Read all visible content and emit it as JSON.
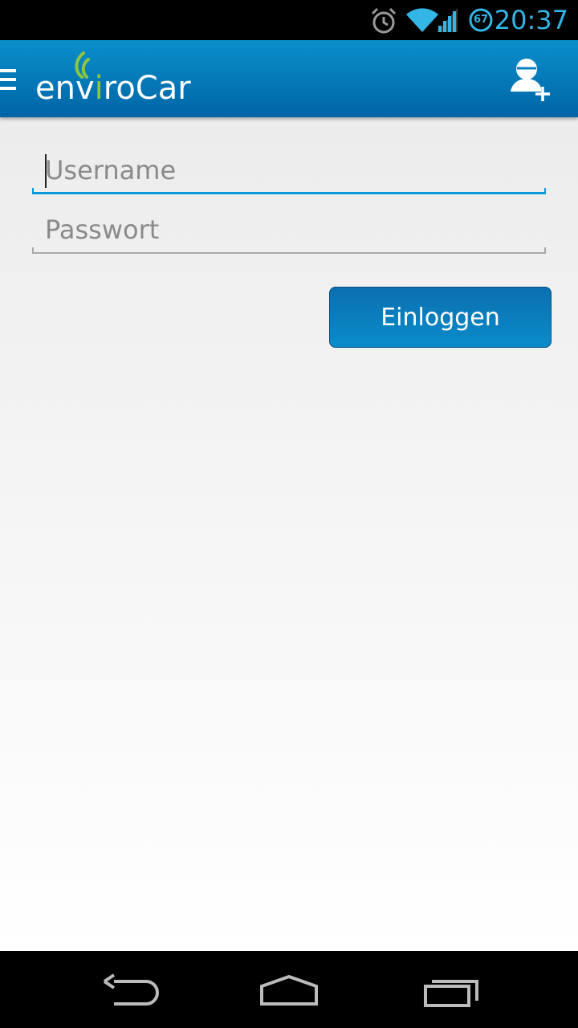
{
  "status_bar": {
    "time": "20:37",
    "battery_level": "67",
    "icons": [
      "alarm-icon",
      "wifi-icon",
      "cell-signal-icon",
      "battery-icon"
    ],
    "accent_color": "#33b5e5"
  },
  "action_bar": {
    "logo": {
      "prefix": "env",
      "accent": "i",
      "suffix": "roCar"
    },
    "icons": [
      "menu-icon",
      "add-user-icon"
    ],
    "brand_color": "#0a7fbf",
    "logo_accent_color": "#8cc63f"
  },
  "login_form": {
    "username": {
      "placeholder": "Username",
      "value": ""
    },
    "password": {
      "placeholder": "Passwort",
      "value": ""
    },
    "submit_label": "Einloggen",
    "focus_color": "#0a9ad8"
  },
  "nav_bar": {
    "icons": [
      "back-icon",
      "home-icon",
      "recent-apps-icon"
    ]
  }
}
